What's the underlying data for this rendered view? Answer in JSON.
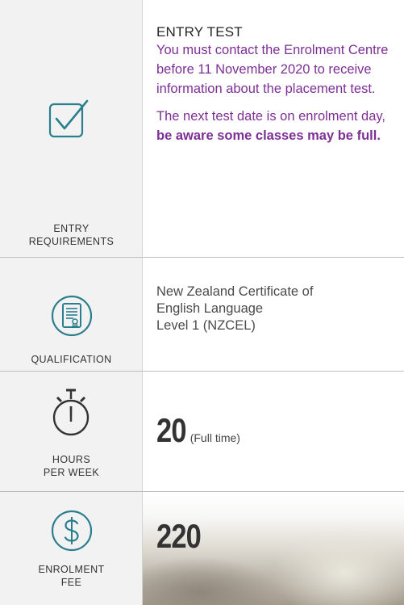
{
  "entry": {
    "label_line1": "ENTRY",
    "label_line2": "REQUIREMENTS",
    "heading": "ENTRY TEST",
    "para1": "You must contact the Enrolment Centre before 11 November 2020 to receive information about the placement test.",
    "para2_prefix": "The next test date is on enrolment day, ",
    "para2_bold": "be aware some classes may be full."
  },
  "qualification": {
    "label": "QUALIFICATION",
    "line1": "New Zealand Certificate of",
    "line2": "English Language",
    "line3": "Level 1 (NZCEL)"
  },
  "hours": {
    "label_line1": "HOURS",
    "label_line2": "PER WEEK",
    "value": "20",
    "unit": "(Full time)"
  },
  "fee": {
    "label_line1": "ENROLMENT",
    "label_line2": "FEE",
    "value": "220"
  },
  "icons": {
    "entry": "checkbox-icon",
    "qualification": "certificate-icon",
    "hours": "stopwatch-icon",
    "fee": "dollar-icon"
  },
  "colors": {
    "accent": "#7d2f96",
    "icon": "#2a7f8f"
  }
}
